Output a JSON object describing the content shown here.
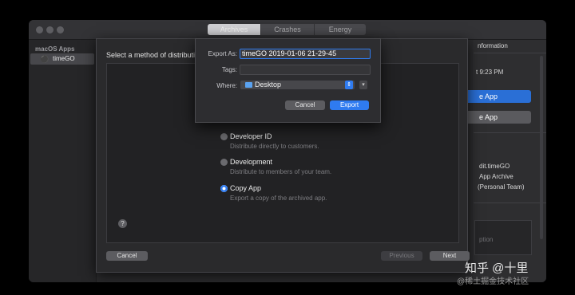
{
  "window": {
    "tabs": [
      "Archives",
      "Crashes",
      "Energy"
    ],
    "selected_tab": "Archives"
  },
  "sidebar": {
    "heading": "macOS Apps",
    "items": [
      {
        "label": "timeGO"
      }
    ]
  },
  "inspector": {
    "header": "nformation",
    "date_fragment": "t 9:23 PM",
    "primary_button": "e App",
    "secondary_button": "e App",
    "identifier": "dit.timeGO",
    "type": "App Archive",
    "team": "(Personal Team)",
    "desc_fragment": "ption"
  },
  "sheet": {
    "prompt": "Select a method of distribution",
    "options": [
      {
        "title": "Developer ID",
        "desc": "Distribute directly to customers.",
        "selected": false
      },
      {
        "title": "Development",
        "desc": "Distribute to members of your team.",
        "selected": false
      },
      {
        "title": "Copy App",
        "desc": "Export a copy of the archived app.",
        "selected": true
      }
    ],
    "help": "?",
    "cancel": "Cancel",
    "previous": "Previous",
    "next": "Next"
  },
  "save_panel": {
    "export_as_label": "Export As:",
    "export_as_value": "timeGO 2019-01-06 21-29-45",
    "tags_label": "Tags:",
    "tags_value": "",
    "where_label": "Where:",
    "where_value": "Desktop",
    "cancel": "Cancel",
    "export": "Export"
  },
  "watermark": {
    "main": "知乎 @十里",
    "sub": "@稀土掘金技术社区"
  },
  "colors": {
    "accent": "#2f7bf0",
    "window_bg": "#2b2b2d",
    "sheet_bg": "#2a2a2c"
  }
}
